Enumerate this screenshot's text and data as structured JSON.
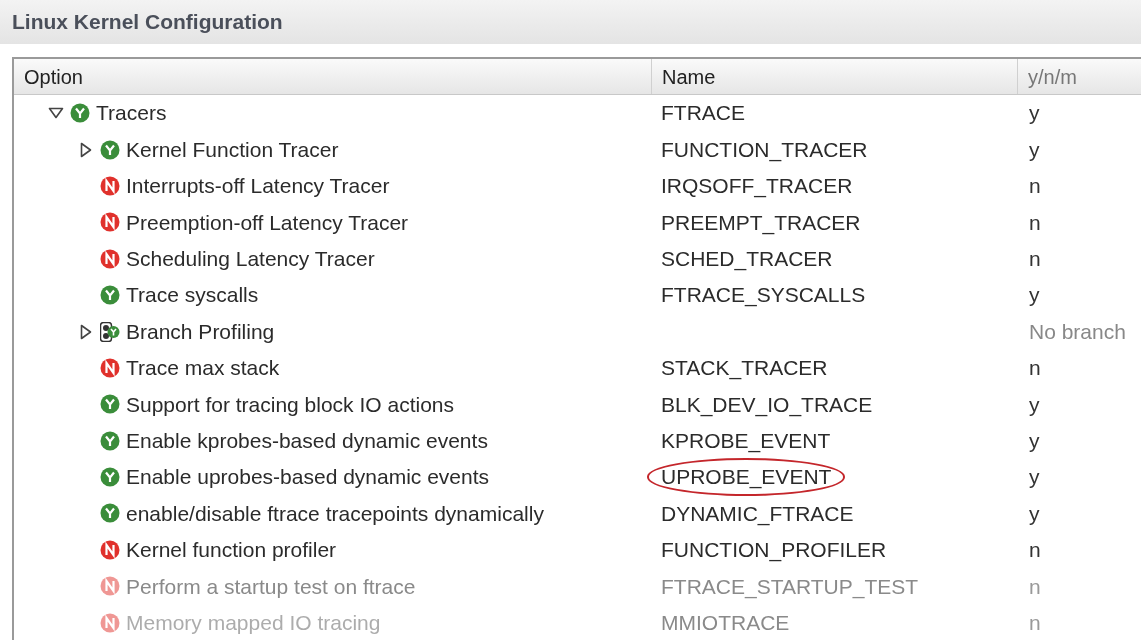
{
  "window": {
    "title": "Linux Kernel Configuration"
  },
  "table": {
    "columns": [
      "Option",
      "Name",
      "y/n/m"
    ],
    "rows": [
      {
        "label": "Tracers",
        "name": "FTRACE",
        "value": "y",
        "kind": "yes",
        "expanded": true,
        "disabled": false,
        "children": [
          {
            "label": "Kernel Function Tracer",
            "name": "FUNCTION_TRACER",
            "value": "y",
            "kind": "yes",
            "expanded": false,
            "disabled": false
          },
          {
            "label": "Interrupts-off Latency Tracer",
            "name": "IRQSOFF_TRACER",
            "value": "n",
            "kind": "no",
            "disabled": false
          },
          {
            "label": "Preemption-off Latency Tracer",
            "name": "PREEMPT_TRACER",
            "value": "n",
            "kind": "no",
            "disabled": false
          },
          {
            "label": "Scheduling Latency Tracer",
            "name": "SCHED_TRACER",
            "value": "n",
            "kind": "no",
            "disabled": false
          },
          {
            "label": "Trace syscalls",
            "name": "FTRACE_SYSCALLS",
            "value": "y",
            "kind": "yes",
            "disabled": false
          },
          {
            "label": "Branch Profiling",
            "value": "No branch",
            "kind": "choice",
            "expanded": false,
            "disabled": false
          },
          {
            "label": "Trace max stack",
            "name": "STACK_TRACER",
            "value": "n",
            "kind": "no",
            "disabled": false
          },
          {
            "label": "Support for tracing block IO actions",
            "name": "BLK_DEV_IO_TRACE",
            "value": "y",
            "kind": "yes",
            "disabled": false
          },
          {
            "label": "Enable kprobes-based dynamic events",
            "name": "KPROBE_EVENT",
            "value": "y",
            "kind": "yes",
            "disabled": false
          },
          {
            "label": "Enable uprobes-based dynamic events",
            "name": "UPROBE_EVENT",
            "value": "y",
            "kind": "yes",
            "disabled": false,
            "highlighted": true
          },
          {
            "label": "enable/disable ftrace tracepoints dynamically",
            "name": "DYNAMIC_FTRACE",
            "value": "y",
            "kind": "yes",
            "disabled": false
          },
          {
            "label": "Kernel function profiler",
            "name": "FUNCTION_PROFILER",
            "value": "n",
            "kind": "no",
            "disabled": false
          },
          {
            "label": "Perform a startup test on ftrace",
            "name": "FTRACE_STARTUP_TEST",
            "value": "n",
            "kind": "no",
            "disabled": true
          },
          {
            "label": "Memory mapped IO tracing",
            "name": "MMIOTRACE",
            "value": "n",
            "kind": "no",
            "disabled": true
          }
        ]
      }
    ]
  }
}
